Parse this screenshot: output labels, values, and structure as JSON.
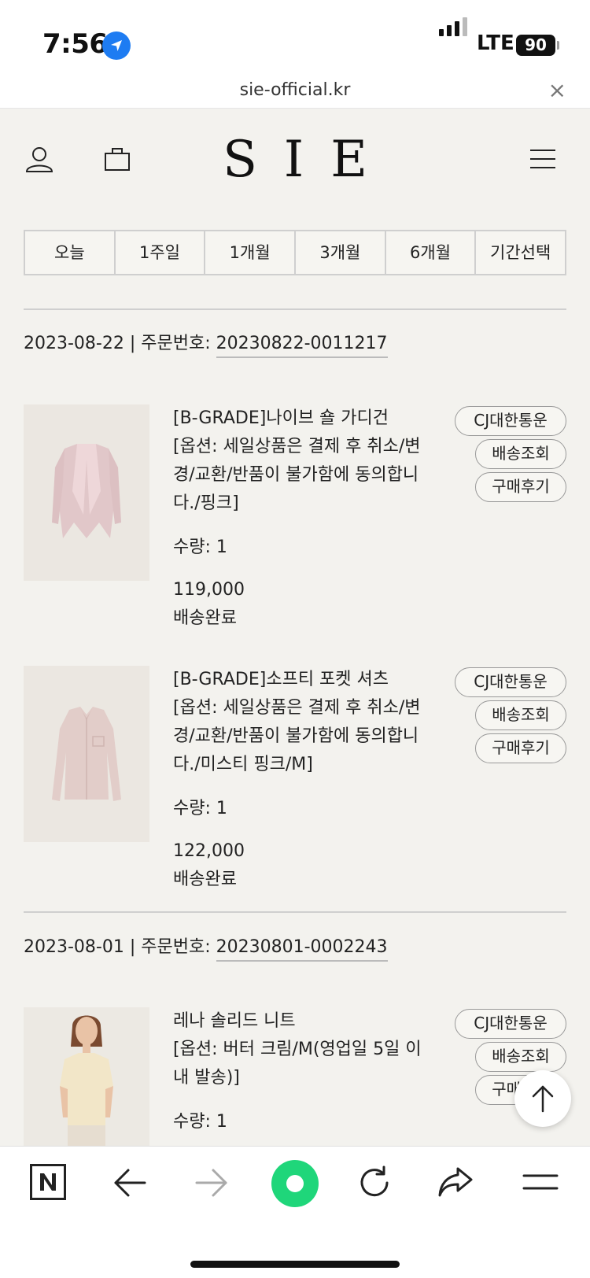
{
  "status_bar": {
    "time": "7:56",
    "network": "LTE",
    "battery": "90"
  },
  "browser": {
    "url": "sie-official.kr",
    "close_glyph": "×"
  },
  "header": {
    "logo": "SIE",
    "icons": [
      "user-icon",
      "cart-icon",
      "menu-icon"
    ]
  },
  "period_tabs": [
    "오늘",
    "1주일",
    "1개월",
    "3개월",
    "6개월",
    "기간선택"
  ],
  "orders": [
    {
      "date": "2023-08-22",
      "separator": " | 주문번호: ",
      "order_number": "20230822-0011217",
      "items": [
        {
          "name": "[B-GRADE]나이브 숄 가디건",
          "option": "[옵션: 세일상품은 결제 후 취소/변경/교환/반품이 불가함에 동의합니다./핑크]",
          "quantity": "수량: 1",
          "price": "119,000",
          "status": "배송완료",
          "buttons": {
            "courier": "CJ대한통운",
            "track": "배송조회",
            "review": "구매후기"
          }
        },
        {
          "name": "[B-GRADE]소프티 포켓 셔츠",
          "option": "[옵션: 세일상품은 결제 후 취소/변경/교환/반품이 불가함에 동의합니다./미스티 핑크/M]",
          "quantity": "수량: 1",
          "price": "122,000",
          "status": "배송완료",
          "buttons": {
            "courier": "CJ대한통운",
            "track": "배송조회",
            "review": "구매후기"
          }
        }
      ]
    },
    {
      "date": "2023-08-01",
      "separator": " | 주문번호: ",
      "order_number": "20230801-0002243",
      "items": [
        {
          "name": "레나 솔리드 니트",
          "option": "[옵션: 버터 크림/M(영업일 5일 이내 발송)]",
          "quantity": "수량: 1",
          "buttons": {
            "courier": "CJ대한통운",
            "track": "배송조회",
            "review": "구매후기"
          }
        }
      ]
    }
  ],
  "toolbar": {
    "icons": [
      "naver-icon",
      "back-arrow-icon",
      "forward-arrow-icon",
      "green-dot-icon",
      "refresh-icon",
      "share-icon",
      "tab-menu-icon"
    ]
  },
  "colors": {
    "background": "#f3f2ee",
    "accent_green": "#1fd67a",
    "location_blue": "#1e7cf2"
  }
}
